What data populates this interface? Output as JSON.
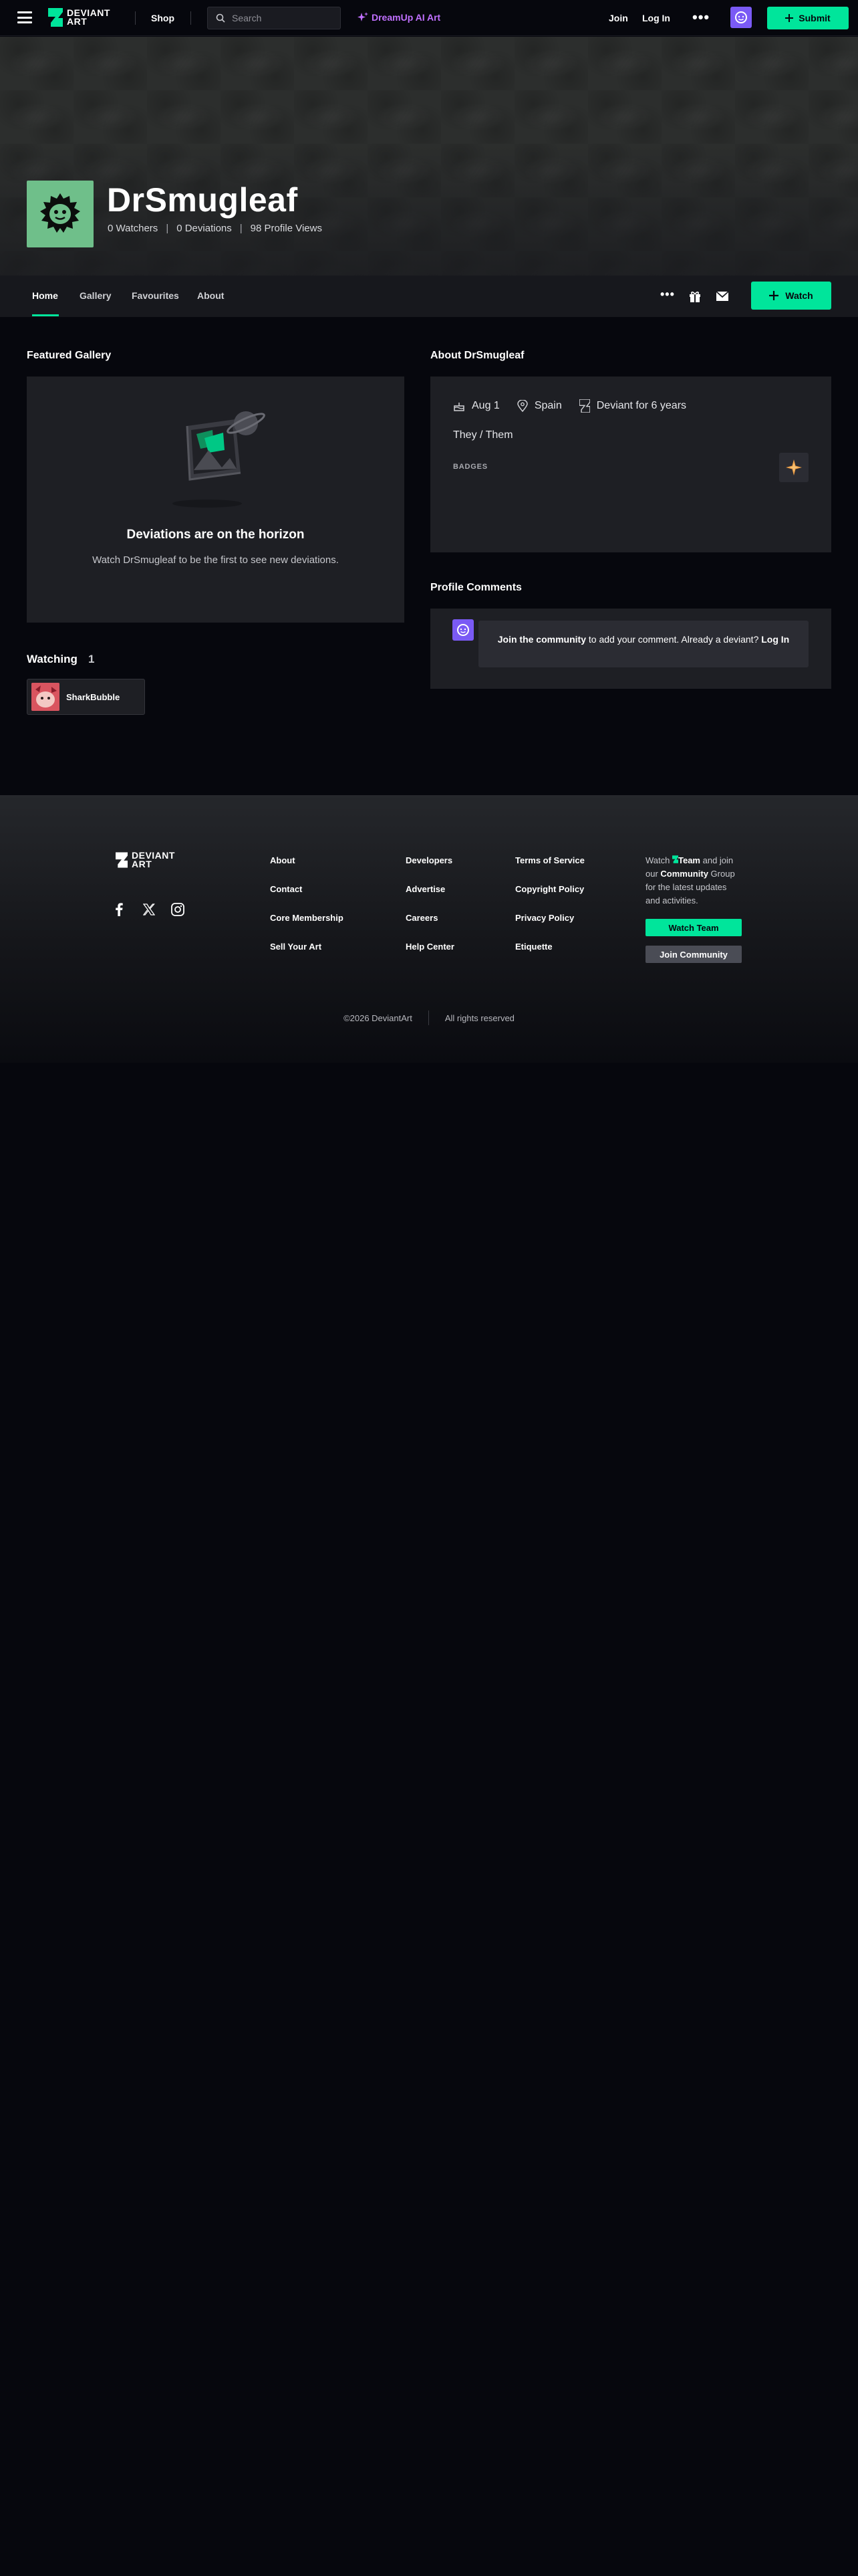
{
  "header": {
    "logo_line1": "DEVIANT",
    "logo_line2": "ART",
    "shop": "Shop",
    "search_placeholder": "Search",
    "dreamup": "DreamUp AI Art",
    "join": "Join",
    "login": "Log In",
    "more": "•••",
    "submit": "Submit"
  },
  "profile": {
    "username": "DrSmugleaf",
    "watchers": "0 Watchers",
    "deviations": "0 Deviations",
    "views": "98 Profile Views",
    "separator": "|",
    "avatar_color": "#6fbf8a"
  },
  "tabs": {
    "items": [
      "Home",
      "Gallery",
      "Favourites",
      "About"
    ],
    "more": "•••",
    "watch": "Watch"
  },
  "featured": {
    "title": "Featured Gallery",
    "empty_title": "Deviations are on the horizon",
    "empty_sub": "Watch DrSmugleaf to be the first to see new deviations."
  },
  "watching": {
    "title": "Watching",
    "count": "1",
    "items": [
      {
        "name": "SharkBubble"
      }
    ]
  },
  "about": {
    "title": "About DrSmugleaf",
    "birthday": "Aug 1",
    "location": "Spain",
    "tenure": "Deviant for 6 years",
    "pronouns": "They / Them",
    "badges_label": "BADGES"
  },
  "comments": {
    "title": "Profile Comments",
    "join_link": "Join the community",
    "text": " to add your comment. Already a deviant? ",
    "login_link": "Log In"
  },
  "footer": {
    "logo_line1": "DEVIANT",
    "logo_line2": "ART",
    "col1": [
      "About",
      "Contact",
      "Core Membership",
      "Sell Your Art"
    ],
    "col2": [
      "Developers",
      "Advertise",
      "Careers",
      "Help Center"
    ],
    "col3": [
      "Terms of Service",
      "Copyright Policy",
      "Privacy Policy",
      "Etiquette"
    ],
    "blurb_watch": "Watch",
    "blurb_team": "Team",
    "blurb_and": "and join our",
    "blurb_community": "Community",
    "blurb_rest": "Group for the latest updates and activities.",
    "watch_team_btn": "Watch Team",
    "join_community_btn": "Join Community",
    "copyright": "©2026 DeviantArt",
    "rights": "All rights reserved"
  },
  "colors": {
    "accent": "#00e59b",
    "dreamup": "#c070ff",
    "background": "#06070d",
    "card": "#1e1f24"
  }
}
